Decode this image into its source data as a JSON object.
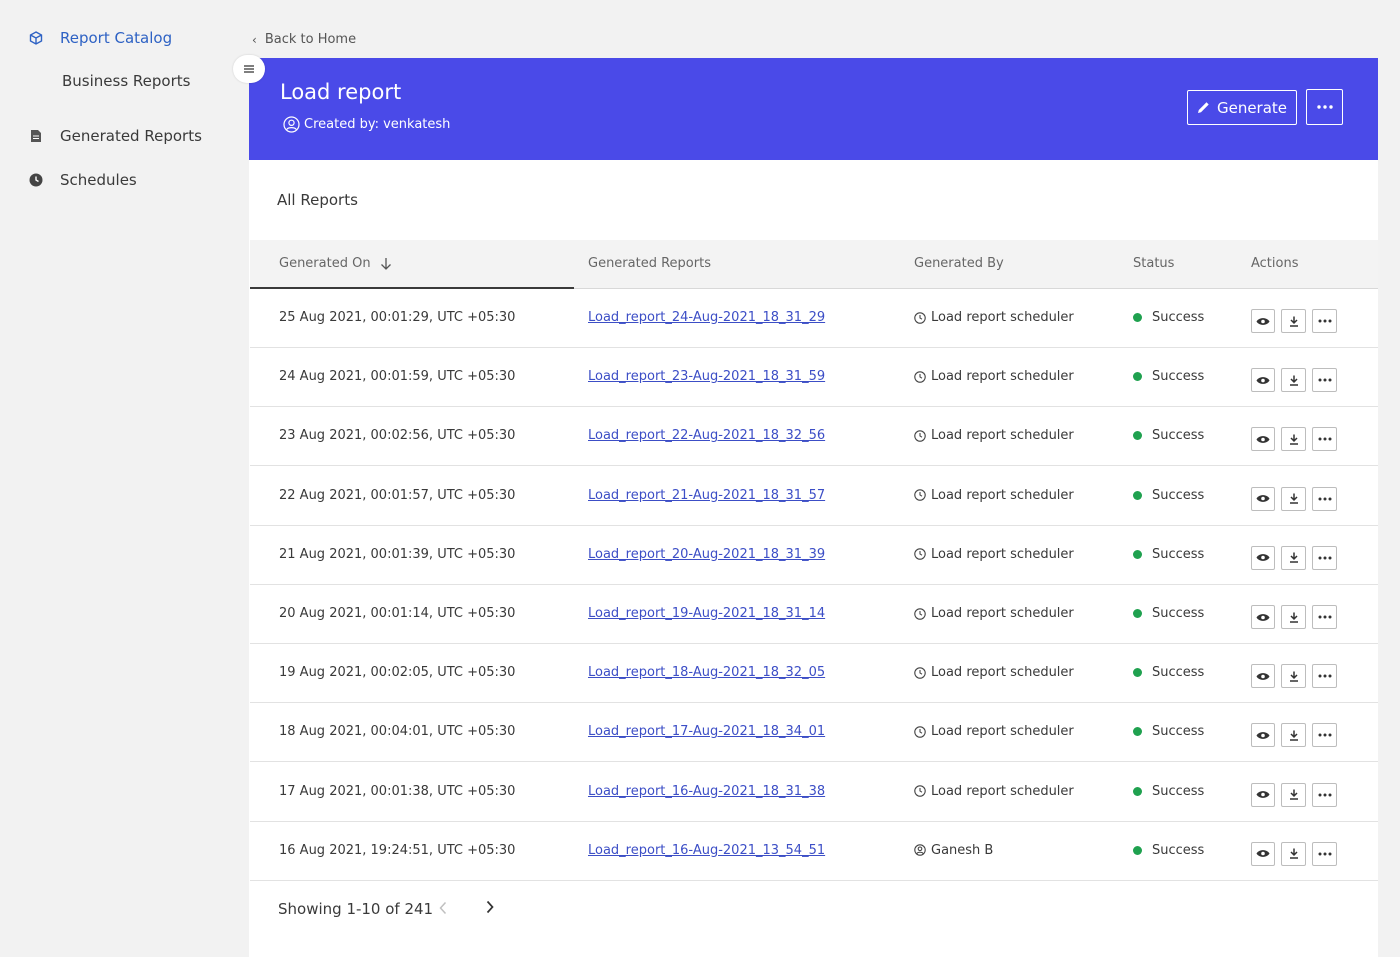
{
  "sidebar": {
    "report_catalog": "Report Catalog",
    "business_reports": "Business Reports",
    "generated_reports": "Generated Reports",
    "schedules": "Schedules"
  },
  "back_link": "Back to Home",
  "header": {
    "title": "Load report",
    "created_by": "Created by: venkatesh",
    "generate_label": "Generate",
    "banner_color": "#4a4ae8"
  },
  "card": {
    "title": "All Reports"
  },
  "table": {
    "columns": [
      "Generated On",
      "Generated Reports",
      "Generated By",
      "Status",
      "Actions"
    ],
    "rows": [
      {
        "generated_on": "25 Aug 2021, 00:01:29, UTC +05:30",
        "report": "Load_report_24-Aug-2021_18_31_29",
        "by": "Load report scheduler",
        "by_icon": "clock-icon",
        "status": "Success"
      },
      {
        "generated_on": "24 Aug 2021, 00:01:59, UTC +05:30",
        "report": "Load_report_23-Aug-2021_18_31_59",
        "by": "Load report scheduler",
        "by_icon": "clock-icon",
        "status": "Success"
      },
      {
        "generated_on": "23 Aug 2021, 00:02:56, UTC +05:30",
        "report": "Load_report_22-Aug-2021_18_32_56",
        "by": "Load report scheduler",
        "by_icon": "clock-icon",
        "status": "Success"
      },
      {
        "generated_on": "22 Aug 2021, 00:01:57, UTC +05:30",
        "report": "Load_report_21-Aug-2021_18_31_57",
        "by": "Load report scheduler",
        "by_icon": "clock-icon",
        "status": "Success"
      },
      {
        "generated_on": "21 Aug 2021, 00:01:39, UTC +05:30",
        "report": "Load_report_20-Aug-2021_18_31_39",
        "by": "Load report scheduler",
        "by_icon": "clock-icon",
        "status": "Success"
      },
      {
        "generated_on": "20 Aug 2021, 00:01:14, UTC +05:30",
        "report": "Load_report_19-Aug-2021_18_31_14",
        "by": "Load report scheduler",
        "by_icon": "clock-icon",
        "status": "Success"
      },
      {
        "generated_on": "19 Aug 2021, 00:02:05, UTC +05:30",
        "report": "Load_report_18-Aug-2021_18_32_05",
        "by": "Load report scheduler",
        "by_icon": "clock-icon",
        "status": "Success"
      },
      {
        "generated_on": "18 Aug 2021, 00:04:01, UTC +05:30",
        "report": "Load_report_17-Aug-2021_18_34_01",
        "by": "Load report scheduler",
        "by_icon": "clock-icon",
        "status": "Success"
      },
      {
        "generated_on": "17 Aug 2021, 00:01:38, UTC +05:30",
        "report": "Load_report_16-Aug-2021_18_31_38",
        "by": "Load report scheduler",
        "by_icon": "clock-icon",
        "status": "Success"
      },
      {
        "generated_on": "16 Aug 2021, 19:24:51, UTC +05:30",
        "report": "Load_report_16-Aug-2021_13_54_51",
        "by": "Ganesh B",
        "by_icon": "user-icon",
        "status": "Success"
      }
    ]
  },
  "pagination": {
    "text": "Showing 1-10 of 241"
  }
}
